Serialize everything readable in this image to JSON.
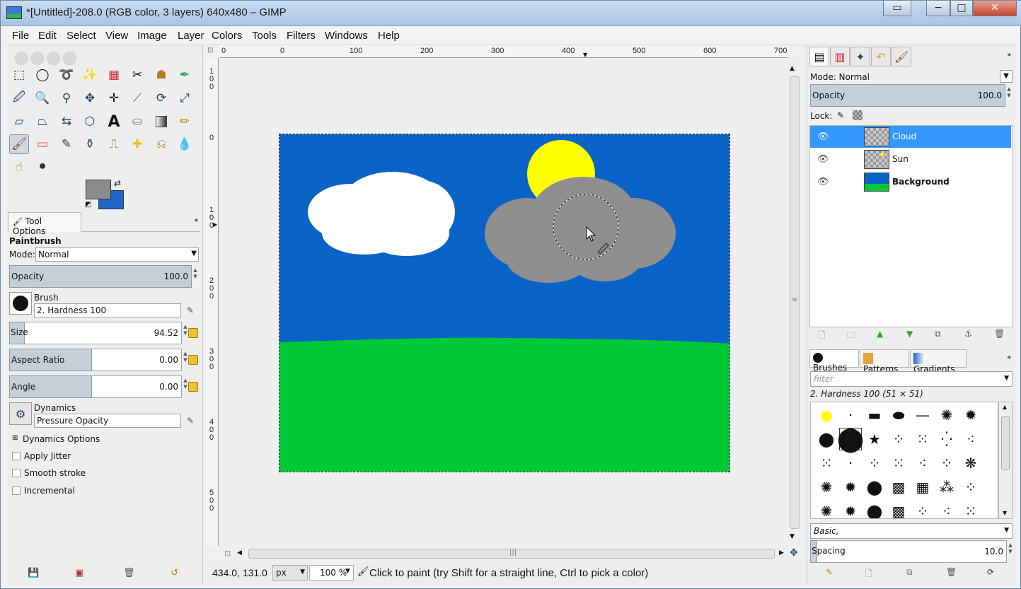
{
  "window": {
    "title": "*[Untitled]-208.0 (RGB color, 3 layers) 640x480 – GIMP",
    "minimize": "−",
    "maximize": "□",
    "close": "✕"
  },
  "menu": [
    "File",
    "Edit",
    "Select",
    "View",
    "Image",
    "Layer",
    "Colors",
    "Tools",
    "Filters",
    "Windows",
    "Help"
  ],
  "toolbox": {
    "colors": {
      "foreground": "#8c8c8c",
      "background": "#1f66c8"
    }
  },
  "tool_options": {
    "tab_label": "Tool Options",
    "tool_name": "Paintbrush",
    "mode_label": "Mode:",
    "mode_value": "Normal",
    "opacity_label": "Opacity",
    "opacity_value": "100.0",
    "brush_label": "Brush",
    "brush_value": "2. Hardness 100",
    "size_label": "Size",
    "size_value": "94.52",
    "aspect_label": "Aspect Ratio",
    "aspect_value": "0.00",
    "angle_label": "Angle",
    "angle_value": "0.00",
    "dynamics_label": "Dynamics",
    "dynamics_value": "Pressure Opacity",
    "dynamics_options": "Dynamics Options",
    "apply_jitter": "Apply Jitter",
    "smooth_stroke": "Smooth stroke",
    "incremental": "Incremental"
  },
  "ruler": {
    "h_labels": [
      "0",
      "0",
      "100",
      "200",
      "300",
      "400",
      "500",
      "600",
      "700"
    ],
    "v_labels": [
      "1\n0\n0",
      "0",
      "1\n0\n0",
      "2\n0\n0",
      "3\n0\n0",
      "4\n0\n0",
      "5\n0\n0"
    ]
  },
  "canvas": {
    "sky_color": "#0a63c6",
    "grass_color": "#00c837",
    "sun_color": "#ffff00",
    "white_cloud_color": "#ffffff",
    "gray_cloud_color": "#8f8f8f"
  },
  "status": {
    "coords": "434.0, 131.0",
    "unit": "px",
    "zoom": "100 %",
    "message": "Click to paint (try Shift for a straight line, Ctrl to pick a color)"
  },
  "layers": {
    "mode_label": "Mode: Normal",
    "opacity_label": "Opacity",
    "opacity_value": "100.0",
    "lock_label": "Lock:",
    "items": [
      {
        "name": "Cloud",
        "selected": true
      },
      {
        "name": "Sun",
        "selected": false
      },
      {
        "name": "Background",
        "selected": false
      }
    ]
  },
  "brushes": {
    "tabs": [
      "Brushes",
      "Patterns",
      "Gradients"
    ],
    "filter_placeholder": "filter",
    "current": "2. Hardness 100 (51 × 51)",
    "tag": "Basic,",
    "spacing_label": "Spacing",
    "spacing_value": "10.0"
  }
}
